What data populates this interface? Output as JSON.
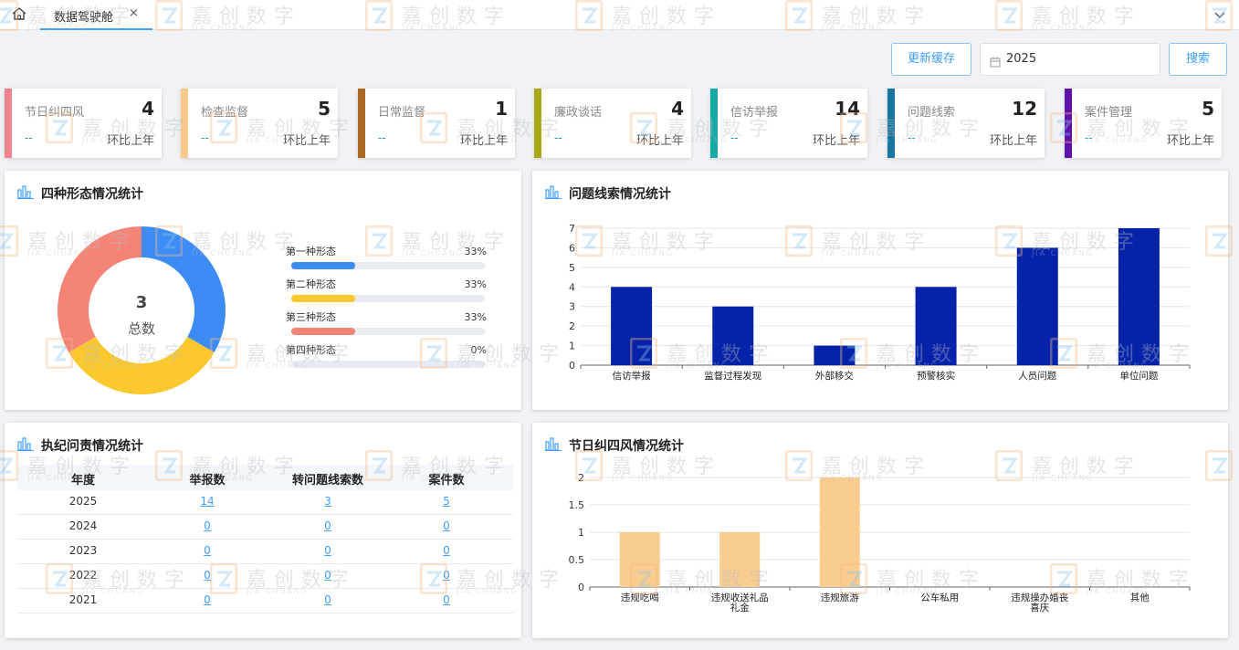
{
  "tabbar": {
    "home_icon": "home-icon",
    "tab_label": "数据驾驶舱",
    "close_glyph": "×",
    "more_icon": "chevron-down-icon"
  },
  "toolbar": {
    "refresh_cache_label": "更新缓存",
    "year_value": "2025",
    "search_label": "搜索"
  },
  "cards": [
    {
      "label": "节日纠四风",
      "count": "4",
      "dash": "--",
      "yoy": "环比上年",
      "color": "#f0838e"
    },
    {
      "label": "检查监督",
      "count": "5",
      "dash": "--",
      "yoy": "环比上年",
      "color": "#f8c98a"
    },
    {
      "label": "日常监督",
      "count": "1",
      "dash": "--",
      "yoy": "环比上年",
      "color": "#a86a22"
    },
    {
      "label": "廉政谈话",
      "count": "4",
      "dash": "--",
      "yoy": "环比上年",
      "color": "#a8a814"
    },
    {
      "label": "信访举报",
      "count": "14",
      "dash": "--",
      "yoy": "环比上年",
      "color": "#16aaa6"
    },
    {
      "label": "问题线索",
      "count": "12",
      "dash": "--",
      "yoy": "环比上年",
      "color": "#16769e"
    },
    {
      "label": "案件管理",
      "count": "5",
      "dash": "--",
      "yoy": "环比上年",
      "color": "#5e12a8"
    }
  ],
  "panel_forms": {
    "title": "四种形态情况统计",
    "icon": "bar-chart-icon",
    "total_value": "3",
    "total_label": "总数",
    "forms": [
      {
        "name": "第一种形态",
        "percent": "33%",
        "fraction": 0.33,
        "color": "#3d8cf5"
      },
      {
        "name": "第二种形态",
        "percent": "33%",
        "fraction": 0.33,
        "color": "#fbc82d"
      },
      {
        "name": "第三种形态",
        "percent": "33%",
        "fraction": 0.33,
        "color": "#f58476"
      },
      {
        "name": "第四种形态",
        "percent": "0%",
        "fraction": 0,
        "color": "#8fb3e8"
      }
    ]
  },
  "panel_clues": {
    "title": "问题线索情况统计",
    "icon": "bar-chart-icon"
  },
  "panel_accountability": {
    "title": "执纪问责情况统计",
    "icon": "bar-chart-icon",
    "columns": [
      "年度",
      "举报数",
      "转问题线索数",
      "案件数"
    ],
    "rows": [
      {
        "year": "2025",
        "reports": "14",
        "clues": "3",
        "cases": "5"
      },
      {
        "year": "2024",
        "reports": "0",
        "clues": "0",
        "cases": "0"
      },
      {
        "year": "2023",
        "reports": "0",
        "clues": "0",
        "cases": "0"
      },
      {
        "year": "2022",
        "reports": "0",
        "clues": "0",
        "cases": "0"
      },
      {
        "year": "2021",
        "reports": "0",
        "clues": "0",
        "cases": "0"
      }
    ]
  },
  "panel_festival": {
    "title": "节日纠四风情况统计",
    "icon": "bar-chart-icon"
  },
  "watermark": {
    "name": "嘉创数字",
    "sub": "JIA CHUANG"
  },
  "chart_data": [
    {
      "type": "pie",
      "categories": [
        "第一种形态",
        "第二种形态",
        "第三种形态",
        "第四种形态"
      ],
      "values": [
        1,
        1,
        1,
        0
      ],
      "colors": [
        "#3d8cf5",
        "#fbc82d",
        "#f58476",
        "#8fb3e8"
      ]
    },
    {
      "type": "bar",
      "categories": [
        "信访举报",
        "监督过程发现",
        "外部移交",
        "预警核实",
        "人员问题",
        "单位问题"
      ],
      "values": [
        4,
        3,
        1,
        4,
        6,
        7
      ],
      "ylim": [
        0,
        7
      ],
      "yticks": [
        "0",
        "1",
        "2",
        "3",
        "4",
        "5",
        "6",
        "7"
      ],
      "grid": true,
      "bar_color": "#0523a8"
    },
    {
      "type": "bar",
      "categories": [
        "违规吃喝",
        "违规收送礼品礼金",
        "违规旅游",
        "公车私用",
        "违规操办婚丧喜庆",
        "其他"
      ],
      "category_lines": [
        [
          "违规吃喝"
        ],
        [
          "违规收送礼品",
          "礼金"
        ],
        [
          "违规旅游"
        ],
        [
          "公车私用"
        ],
        [
          "违规操办婚丧",
          "喜庆"
        ],
        [
          "其他"
        ]
      ],
      "values": [
        1,
        1,
        2,
        0,
        0,
        0
      ],
      "ylim": [
        0,
        2
      ],
      "yticks": [
        "0",
        "0.5",
        "1",
        "1.5",
        "2"
      ],
      "grid": true,
      "bar_color": "#f9cc8f"
    }
  ]
}
